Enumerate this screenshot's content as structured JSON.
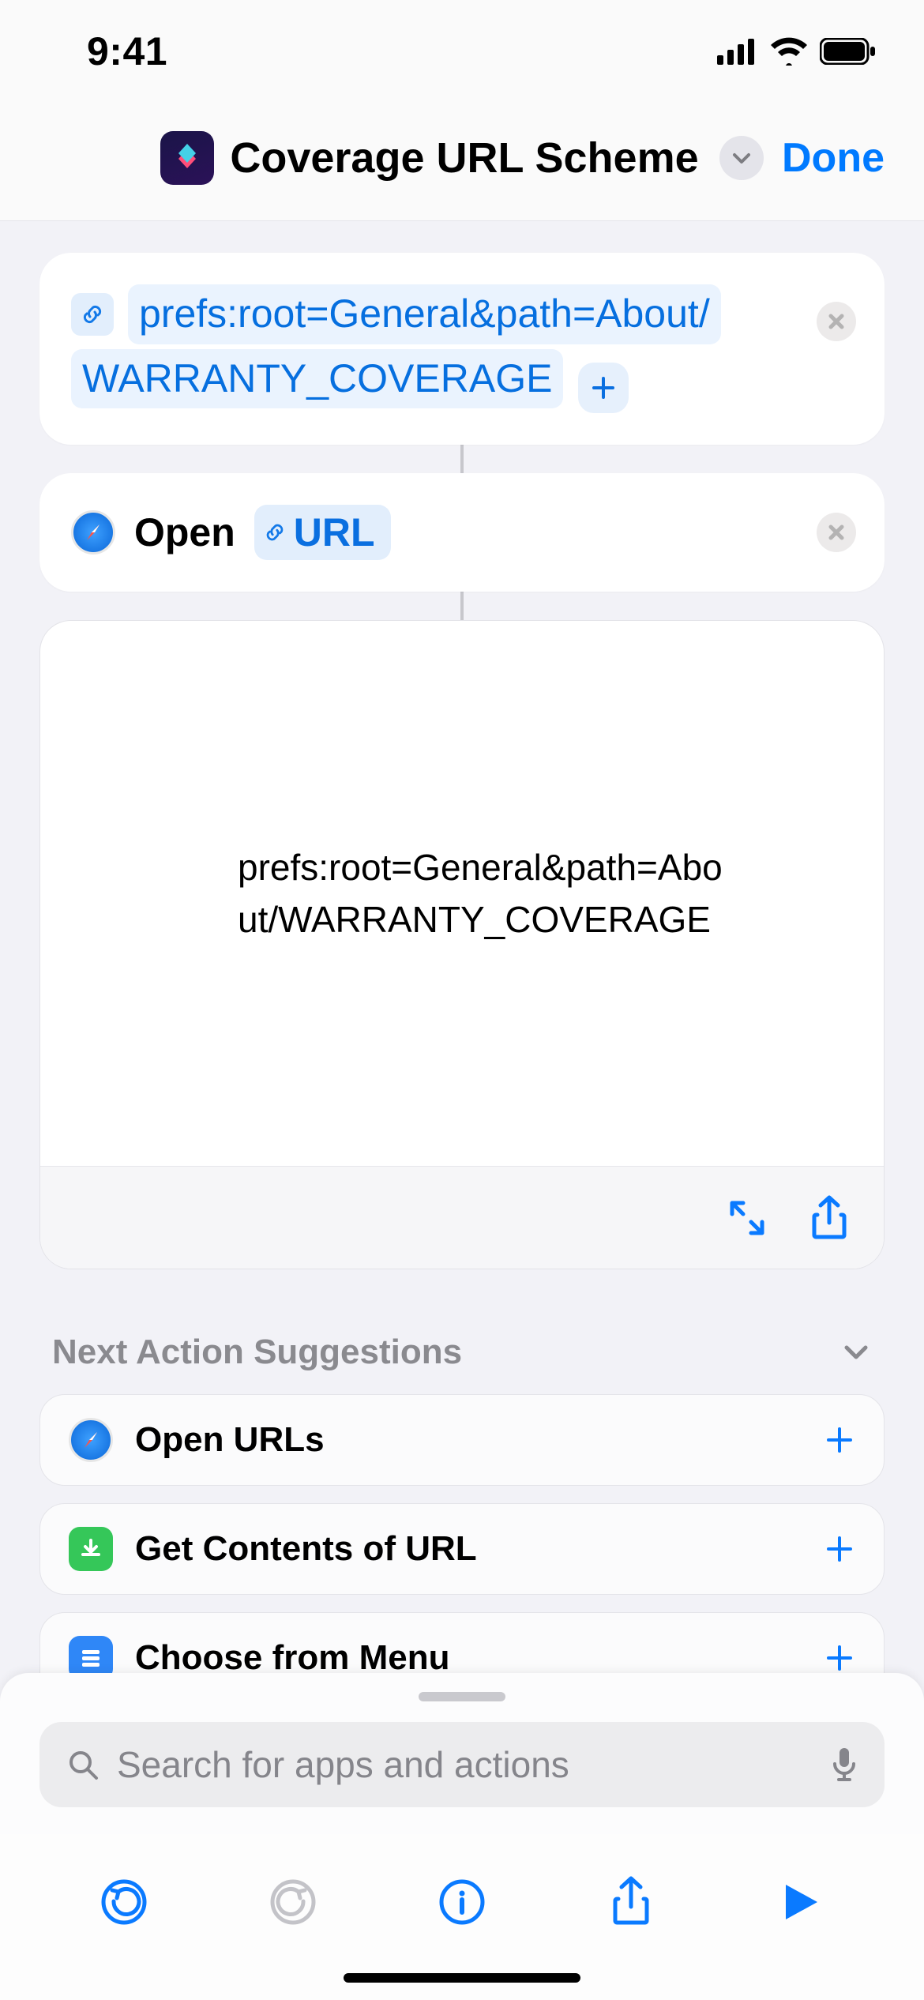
{
  "status": {
    "time": "9:41"
  },
  "header": {
    "title": "Coverage URL Scheme",
    "done_label": "Done"
  },
  "action_url": {
    "token_line1": "prefs:root=General&path=About/",
    "token_line2": "WARRANTY_COVERAGE"
  },
  "action_open": {
    "verb": "Open",
    "param_label": "URL"
  },
  "result": {
    "text": "prefs:root=General&path=About/WARRANTY_COVERAGE"
  },
  "suggestions": {
    "heading": "Next Action Suggestions",
    "items": [
      {
        "label": "Open URLs",
        "icon": "safari",
        "color": "#167ee6"
      },
      {
        "label": "Get Contents of URL",
        "icon": "download",
        "color": "#35c759"
      },
      {
        "label": "Choose from Menu",
        "icon": "menu",
        "color": "#2f87f7"
      }
    ]
  },
  "search": {
    "placeholder": "Search for apps and actions"
  }
}
